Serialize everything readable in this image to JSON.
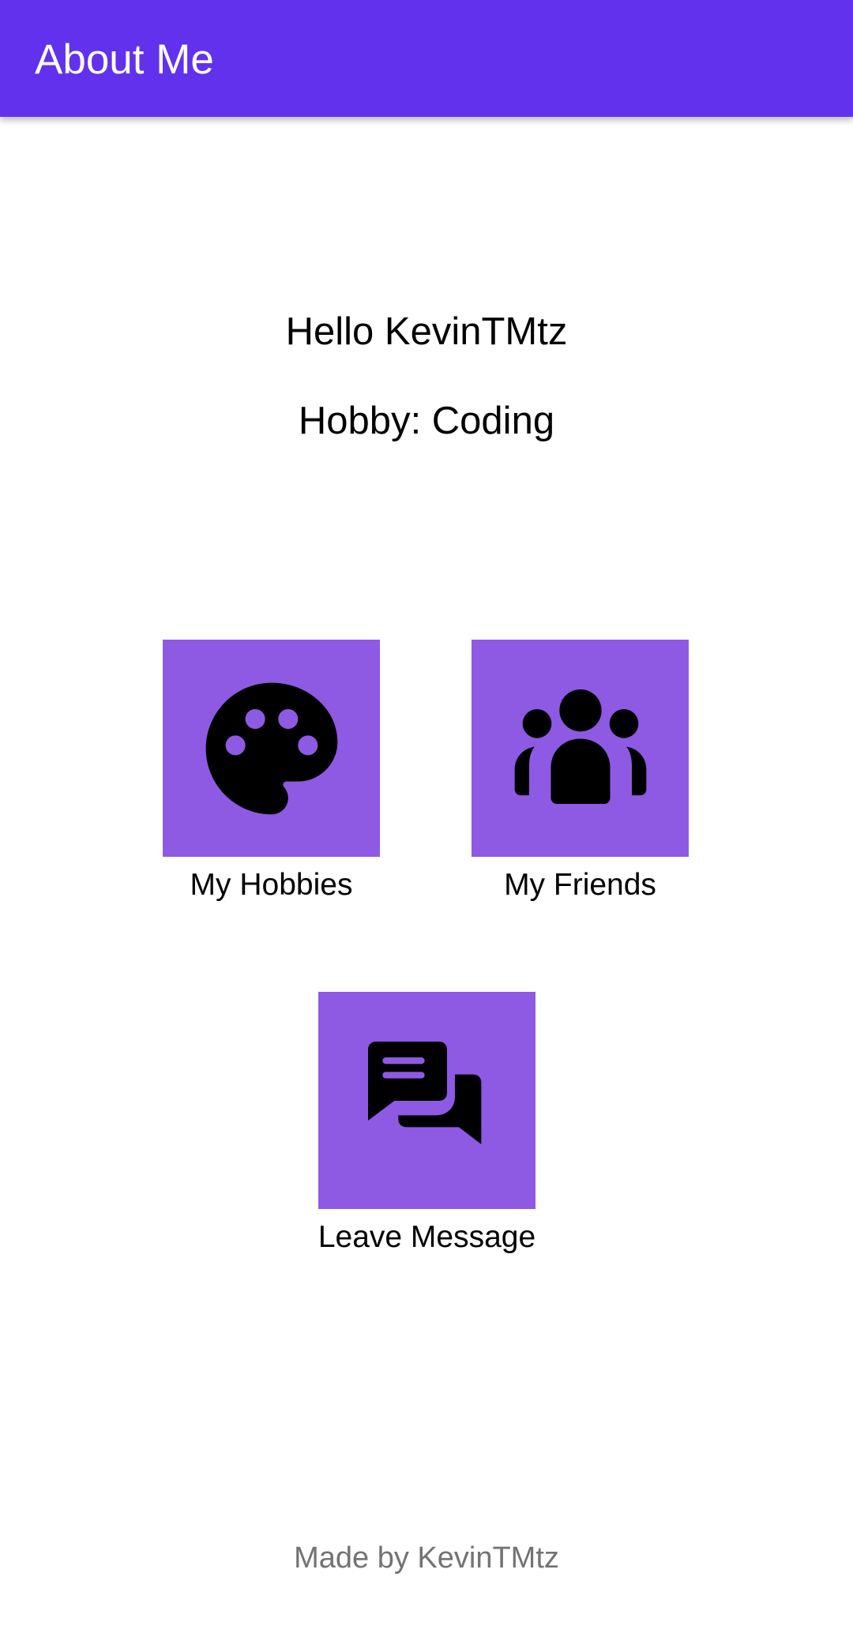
{
  "app_bar": {
    "title": "About Me",
    "color": "#6231EE"
  },
  "profile": {
    "greeting": "Hello KevinTMtz",
    "hobby": "Hobby: Coding"
  },
  "tiles": [
    {
      "label": "My Hobbies",
      "icon": "palette-icon"
    },
    {
      "label": "My Friends",
      "icon": "group-icon"
    },
    {
      "label": "Leave Message",
      "icon": "forum-icon"
    }
  ],
  "tile_color": "#8E5AE3",
  "footer": {
    "text": "Made by KevinTMtz"
  }
}
